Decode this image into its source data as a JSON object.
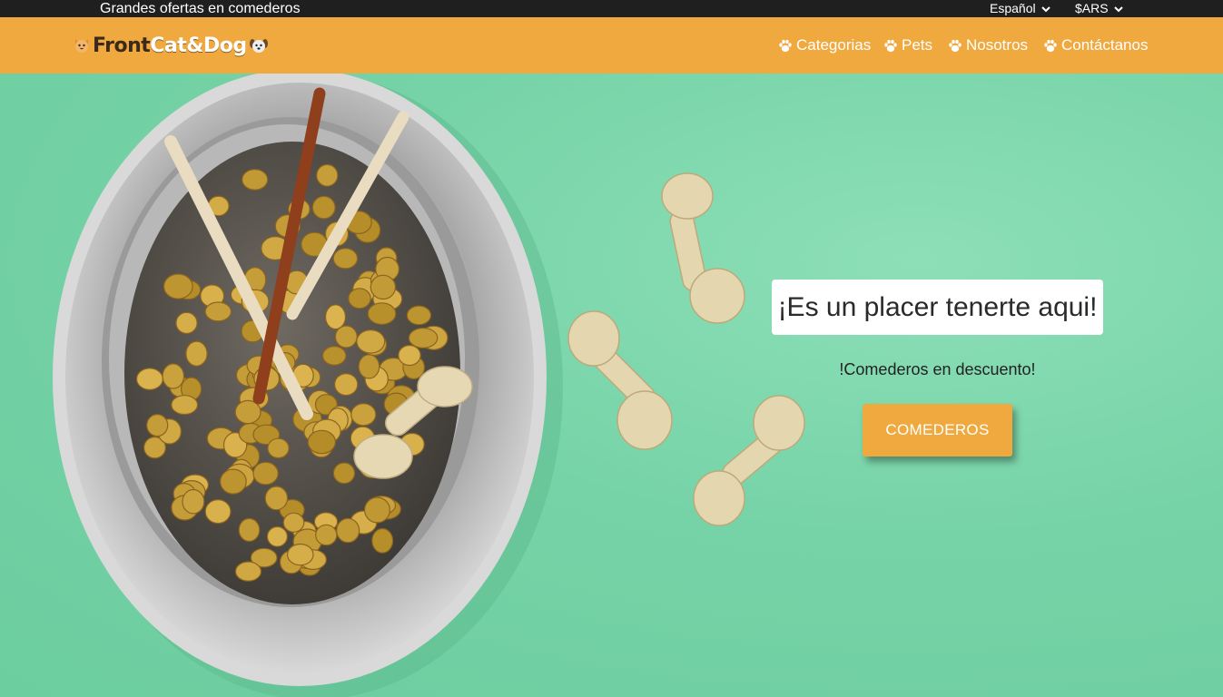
{
  "topbar": {
    "promo": "Grandes ofertas en comederos",
    "language": "Español",
    "currency": "$ARS"
  },
  "brand": {
    "part1": "Front",
    "part2": "Cat&Dog"
  },
  "nav": {
    "items": [
      {
        "label": "Categorias",
        "icon": "paw-icon"
      },
      {
        "label": "Pets",
        "icon": "paw-icon"
      },
      {
        "label": "Nosotros",
        "icon": "paw-icon"
      },
      {
        "label": "Contáctanos",
        "icon": "paw-icon"
      }
    ]
  },
  "hero": {
    "title": "¡Es un placer tenerte aqui!",
    "subtitle": "!Comederos en descuento!",
    "cta_label": "COMEDEROS"
  },
  "colors": {
    "accent": "#f0a93f",
    "topbar": "#1f1f1f",
    "hero_bg": "#74d3a6"
  }
}
